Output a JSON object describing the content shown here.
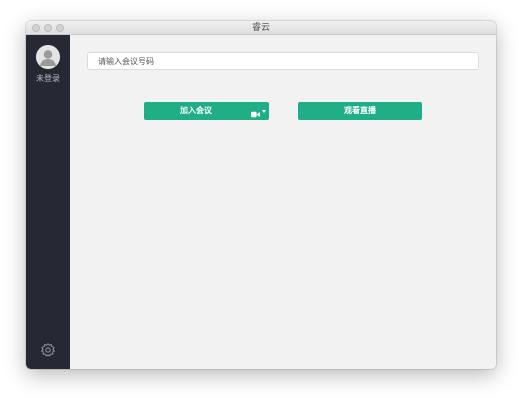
{
  "window": {
    "title": "睿云"
  },
  "sidebar": {
    "avatar_icon": "user-avatar-icon",
    "login_status": "未登录",
    "settings_icon": "gear-icon"
  },
  "main": {
    "meeting_input": {
      "placeholder": "请输入会议号码",
      "value": ""
    },
    "join_button": {
      "label": "加入会议",
      "menu_icon": "video-camera-icon"
    },
    "live_button": {
      "label": "观看直播"
    }
  },
  "colors": {
    "accent": "#1fae86",
    "sidebar_bg": "#262833",
    "main_bg": "#f2f2f2"
  }
}
